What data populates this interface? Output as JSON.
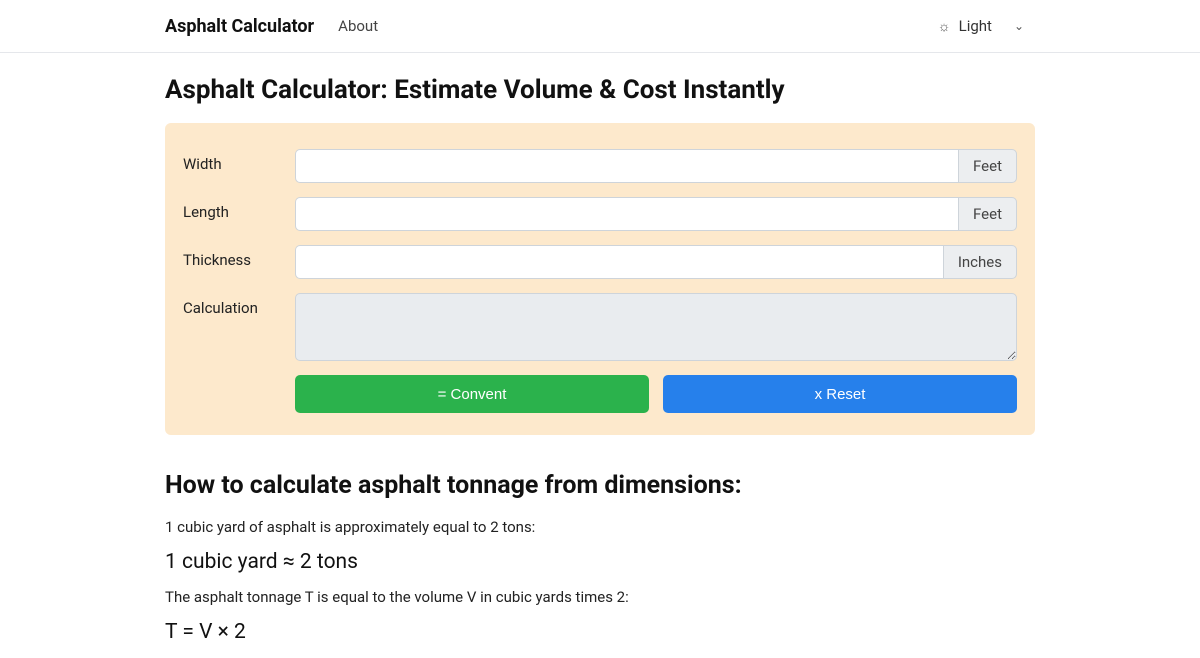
{
  "nav": {
    "brand": "Asphalt Calculator",
    "about": "About",
    "theme_label": "Light"
  },
  "page": {
    "title": "Asphalt Calculator: Estimate Volume & Cost Instantly"
  },
  "form": {
    "width_label": "Width",
    "width_value": "",
    "width_unit": "Feet",
    "length_label": "Length",
    "length_value": "",
    "length_unit": "Feet",
    "thickness_label": "Thickness",
    "thickness_value": "",
    "thickness_unit": "Inches",
    "calculation_label": "Calculation",
    "calculation_value": "",
    "convert_btn": "= Convent",
    "reset_btn": "x Reset"
  },
  "explain": {
    "heading": "How to calculate asphalt tonnage from dimensions:",
    "line1": "1 cubic yard of asphalt is approximately equal to 2 tons:",
    "formula1": "1 cubic yard ≈ 2 tons",
    "line2": "The asphalt tonnage T is equal to the volume V in cubic yards times 2:",
    "formula2": "T = V × 2"
  }
}
